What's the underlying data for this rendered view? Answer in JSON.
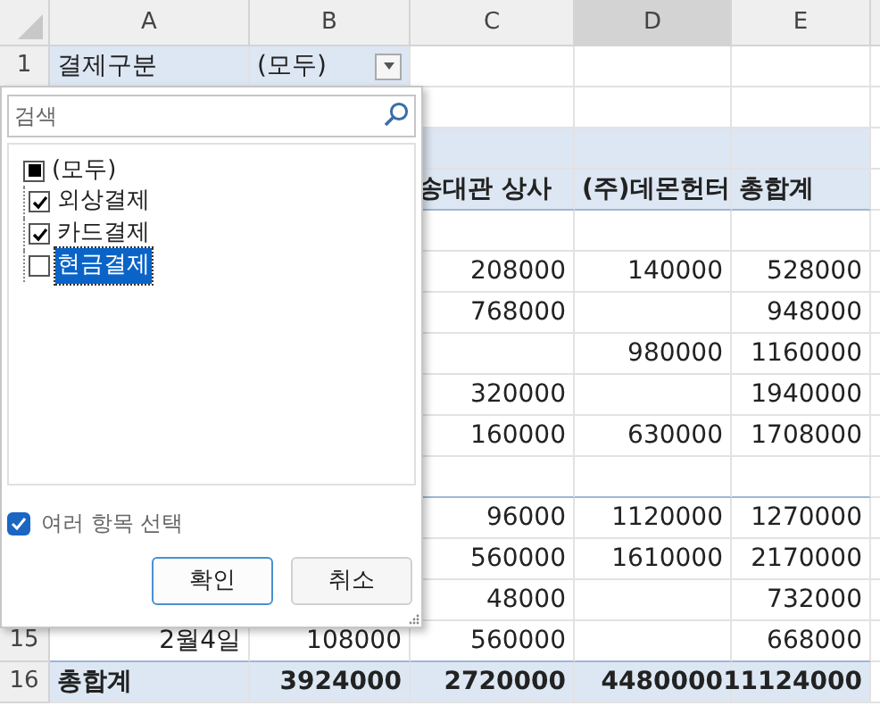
{
  "columns": [
    {
      "label": "A",
      "selected": false
    },
    {
      "label": "B",
      "selected": false
    },
    {
      "label": "C",
      "selected": false
    },
    {
      "label": "D",
      "selected": true
    },
    {
      "label": "E",
      "selected": false
    }
  ],
  "rows": [
    {
      "number": "1",
      "kind": "filter",
      "cells": {
        "a": "결제구분",
        "b": "(모두)"
      }
    },
    {
      "kind": "blank"
    },
    {
      "kind": "header-top"
    },
    {
      "kind": "header",
      "cells": {
        "c": "송대관 상사",
        "d": "(주)데몬헌터",
        "e": "총합계"
      }
    },
    {
      "kind": "blank"
    },
    {
      "kind": "data",
      "cells": {
        "c": "208000",
        "d": "140000",
        "e": "528000"
      }
    },
    {
      "kind": "data",
      "cells": {
        "c": "768000",
        "e": "948000"
      }
    },
    {
      "kind": "data",
      "cells": {
        "d": "980000",
        "e": "1160000"
      }
    },
    {
      "kind": "data",
      "cells": {
        "c": "320000",
        "e": "1940000"
      }
    },
    {
      "kind": "data",
      "cells": {
        "c": "160000",
        "d": "630000",
        "e": "1708000"
      }
    },
    {
      "kind": "blank"
    },
    {
      "kind": "data",
      "cells": {
        "c": "96000",
        "d": "1120000",
        "e": "1270000"
      }
    },
    {
      "kind": "data",
      "cells": {
        "c": "560000",
        "d": "1610000",
        "e": "2170000"
      }
    },
    {
      "kind": "data",
      "cells": {
        "c": "48000",
        "e": "732000"
      }
    },
    {
      "number": "15",
      "kind": "data",
      "cells": {
        "a": "2월4일",
        "b": "108000",
        "c": "560000",
        "e": "668000"
      }
    },
    {
      "number": "16",
      "kind": "total",
      "cells": {
        "a": "총합계",
        "b": "3924000",
        "c": "2720000",
        "d": "4480000",
        "e": "11124000"
      }
    }
  ],
  "filter_popup": {
    "search": {
      "placeholder": "검색"
    },
    "items": [
      {
        "label": "(모두)",
        "checked": false,
        "indeterminate": true,
        "selected": false,
        "children": [
          {
            "label": "외상결제",
            "checked": true,
            "selected": false
          },
          {
            "label": "카드결제",
            "checked": true,
            "selected": false
          },
          {
            "label": "현금결제",
            "checked": false,
            "selected": true
          }
        ]
      }
    ],
    "multi_select": {
      "label": "여러 항목 선택",
      "checked": true
    },
    "buttons": [
      {
        "label": "확인",
        "default": true
      },
      {
        "label": "취소",
        "default": false
      }
    ]
  }
}
